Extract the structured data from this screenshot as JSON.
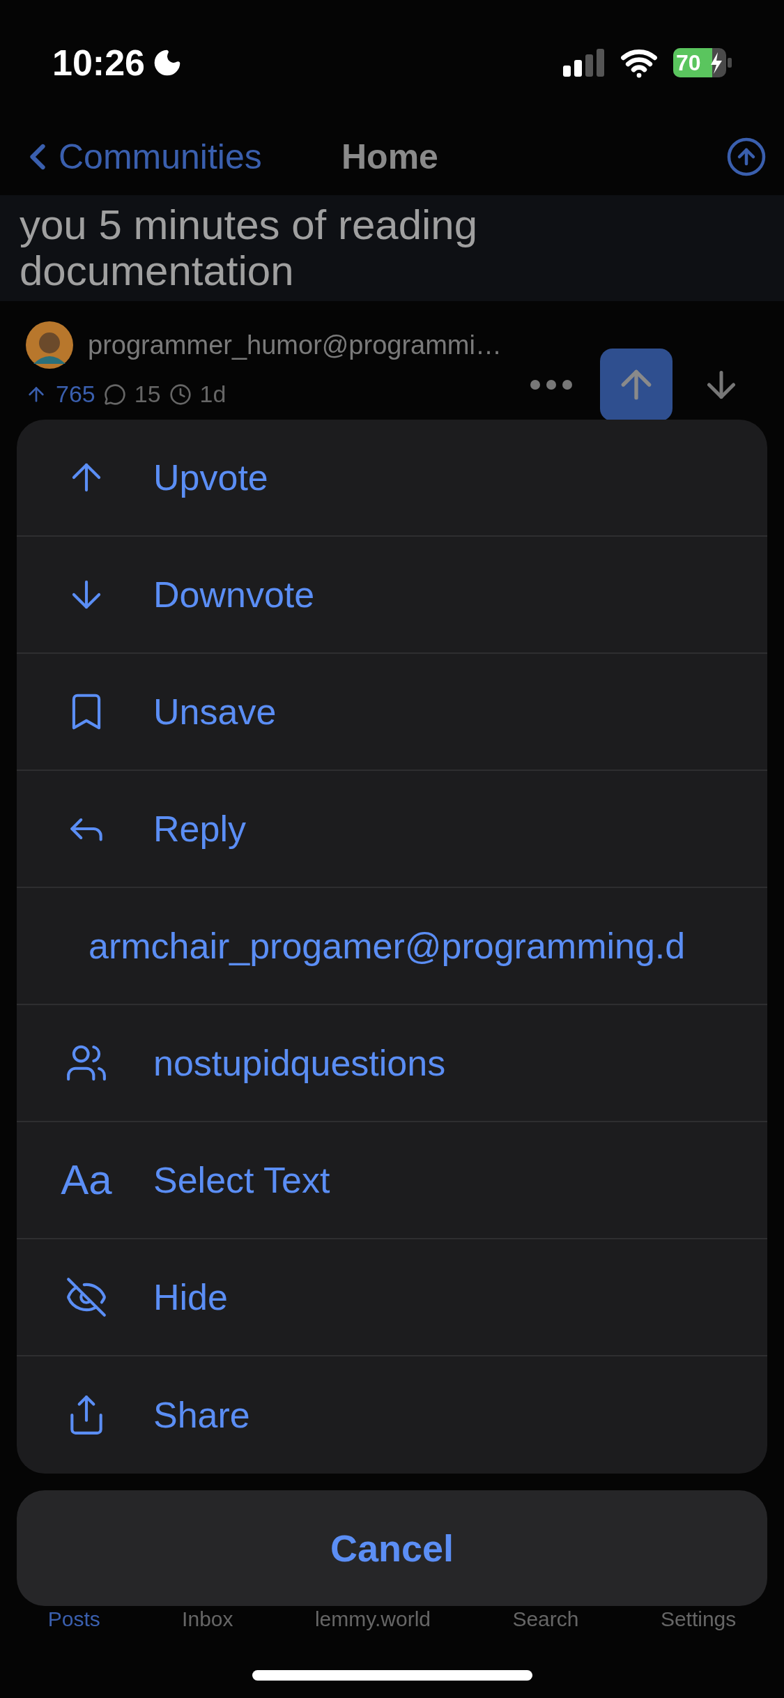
{
  "status_bar": {
    "time": "10:26",
    "battery": "70"
  },
  "nav": {
    "back_label": "Communities",
    "title": "Home"
  },
  "post": {
    "title_lines": [
      "you 5 minutes of reading",
      "documentation"
    ],
    "community": "programmer_humor@programmi…",
    "score": "765",
    "comments": "15",
    "age": "1d",
    "upvoted": true
  },
  "action_sheet": {
    "items": [
      {
        "kind": "upvote",
        "label": "Upvote"
      },
      {
        "kind": "downvote",
        "label": "Downvote"
      },
      {
        "kind": "bookmark",
        "label": "Unsave"
      },
      {
        "kind": "reply",
        "label": "Reply"
      },
      {
        "kind": "user",
        "label": "armchair_progamer@programming.d"
      },
      {
        "kind": "community",
        "label": "nostupidquestions"
      },
      {
        "kind": "text",
        "icon_text": "Aa",
        "label": "Select Text"
      },
      {
        "kind": "hide",
        "label": "Hide"
      },
      {
        "kind": "share",
        "label": "Share"
      }
    ],
    "cancel": "Cancel"
  },
  "tab_bar": [
    {
      "label": "Posts",
      "selected": true
    },
    {
      "label": "Inbox",
      "selected": false
    },
    {
      "label": "lemmy.world",
      "selected": false
    },
    {
      "label": "Search",
      "selected": false
    },
    {
      "label": "Settings",
      "selected": false
    }
  ]
}
